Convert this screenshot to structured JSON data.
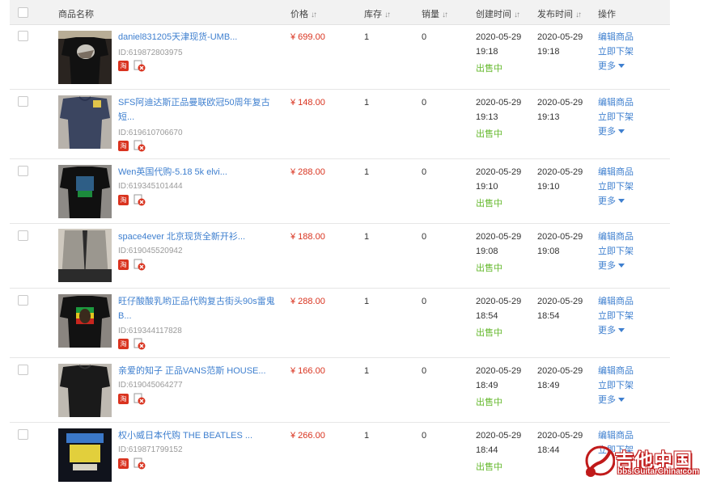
{
  "header": {
    "product_name": "商品名称",
    "price": "价格",
    "stock": "库存",
    "sales": "销量",
    "created": "创建时间",
    "published": "发布时间",
    "actions": "操作"
  },
  "actions": {
    "edit": "编辑商品",
    "delist": "立即下架",
    "more": "更多"
  },
  "badges": {
    "tao": "淘"
  },
  "products": [
    {
      "title": "daniel831205天津现货-UMB...",
      "id": "ID:619872803975",
      "price": "¥ 699.00",
      "stock": "1",
      "sales": "0",
      "created_date": "2020-05-29",
      "created_time": "19:18",
      "status": "出售中",
      "published_date": "2020-05-29",
      "published_time": "19:18"
    },
    {
      "title": "SFS阿迪达斯正品曼联欧冠50周年复古短...",
      "id": "ID:619610706670",
      "price": "¥ 148.00",
      "stock": "1",
      "sales": "0",
      "created_date": "2020-05-29",
      "created_time": "19:13",
      "status": "出售中",
      "published_date": "2020-05-29",
      "published_time": "19:13"
    },
    {
      "title": "Wen英国代购-5.18 5k elvi...",
      "id": "ID:619345101444",
      "price": "¥ 288.00",
      "stock": "1",
      "sales": "0",
      "created_date": "2020-05-29",
      "created_time": "19:10",
      "status": "出售中",
      "published_date": "2020-05-29",
      "published_time": "19:10"
    },
    {
      "title": "space4ever 北京现货全新开衫...",
      "id": "ID:619045520942",
      "price": "¥ 188.00",
      "stock": "1",
      "sales": "0",
      "created_date": "2020-05-29",
      "created_time": "19:08",
      "status": "出售中",
      "published_date": "2020-05-29",
      "published_time": "19:08"
    },
    {
      "title": "旺仔酸酸乳哟正品代购复古街头90s雷鬼B...",
      "id": "ID:619344117828",
      "price": "¥ 288.00",
      "stock": "1",
      "sales": "0",
      "created_date": "2020-05-29",
      "created_time": "18:54",
      "status": "出售中",
      "published_date": "2020-05-29",
      "published_time": "18:54"
    },
    {
      "title": "亲爱的知子 正品VANS范斯 HOUSE...",
      "id": "ID:619045064277",
      "price": "¥ 166.00",
      "stock": "1",
      "sales": "0",
      "created_date": "2020-05-29",
      "created_time": "18:49",
      "status": "出售中",
      "published_date": "2020-05-29",
      "published_time": "18:49"
    },
    {
      "title": "权小威日本代购 THE BEATLES ...",
      "id": "ID:619871799152",
      "price": "¥ 266.00",
      "stock": "1",
      "sales": "0",
      "created_date": "2020-05-29",
      "created_time": "18:44",
      "status": "出售中",
      "published_date": "2020-05-29",
      "published_time": "18:44"
    }
  ],
  "watermark": {
    "title": "吉他中国",
    "url": "bbs.GuitarChina.com"
  },
  "colors": {
    "link": "#3e7fcf",
    "price": "#d9331f",
    "on_sale": "#66b92e",
    "header_bg": "#f2f2f2"
  }
}
